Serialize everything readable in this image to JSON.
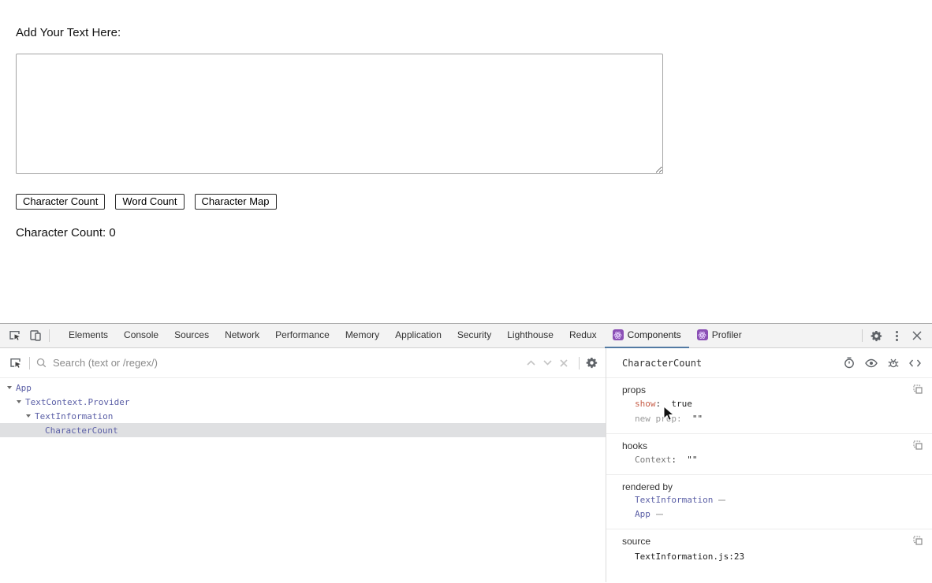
{
  "page": {
    "heading": "Add Your Text Here:",
    "textarea_value": "",
    "buttons": [
      "Character Count",
      "Word Count",
      "Character Map"
    ],
    "count_text": "Character Count: 0"
  },
  "devtools": {
    "tabs": [
      {
        "label": "Elements"
      },
      {
        "label": "Console"
      },
      {
        "label": "Sources"
      },
      {
        "label": "Network"
      },
      {
        "label": "Performance"
      },
      {
        "label": "Memory"
      },
      {
        "label": "Application"
      },
      {
        "label": "Security"
      },
      {
        "label": "Lighthouse"
      },
      {
        "label": "Redux"
      },
      {
        "label": "Components",
        "icon": "react",
        "active": true
      },
      {
        "label": "Profiler",
        "icon": "react"
      }
    ],
    "search": {
      "placeholder": "Search (text or /regex/)"
    },
    "tree": [
      {
        "name": "App",
        "depth": 0
      },
      {
        "name": "TextContext.Provider",
        "depth": 1
      },
      {
        "name": "TextInformation",
        "depth": 2
      },
      {
        "name": "CharacterCount",
        "depth": 3,
        "selected": true
      }
    ],
    "panel": {
      "title": "CharacterCount",
      "props": {
        "label": "props",
        "items": [
          {
            "key": "show",
            "value": "true"
          },
          {
            "key": "new prop",
            "value": "\"\""
          }
        ]
      },
      "hooks": {
        "label": "hooks",
        "items": [
          {
            "key": "Context",
            "value": "\"\""
          }
        ]
      },
      "rendered_by": {
        "label": "rendered by",
        "owners": [
          "TextInformation",
          "App"
        ]
      },
      "source": {
        "label": "source",
        "value": "TextInformation.js:23"
      }
    },
    "colors": {
      "accent_tab_underline": "#527aa3",
      "react_icon_purple": "#8b50b5",
      "component_name": "#5b5fa6",
      "prop_key": "#c75f49",
      "selected_row_bg": "#dfe0e2",
      "toolbar_bg": "#f3f3f3"
    }
  }
}
